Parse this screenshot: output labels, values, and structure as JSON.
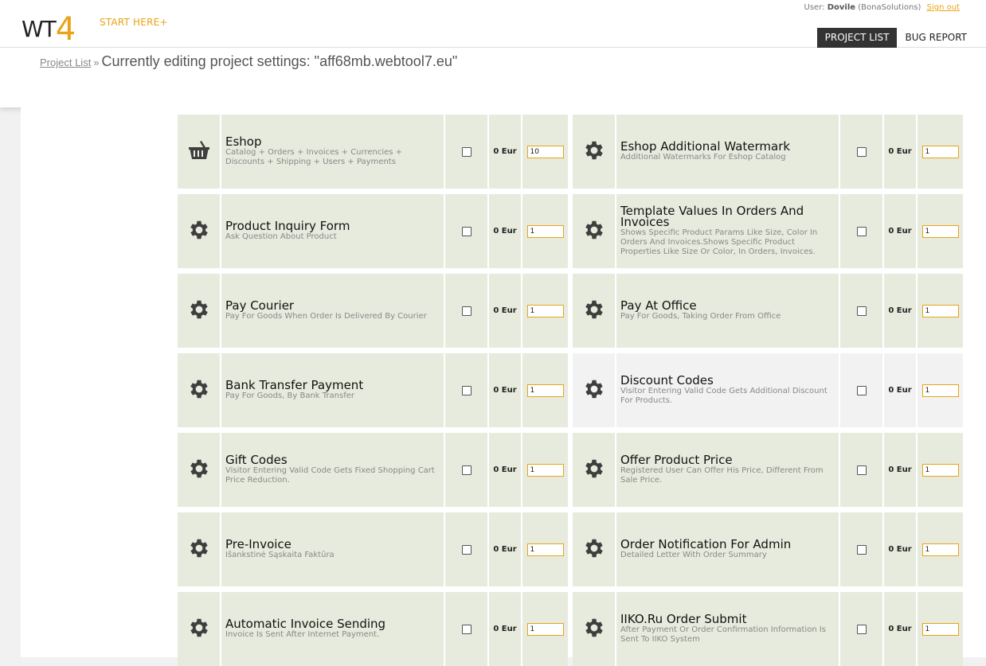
{
  "header": {
    "logo_text": "WT",
    "logo_accent": "4",
    "start_here": "START HERE+",
    "user_prefix": "User:",
    "user_name": "Dovile",
    "user_org": "(BonaSolutions)",
    "sign_out": "Sign out",
    "nav": {
      "project_list": "PROJECT LIST",
      "bug_report": "BUG REPORT"
    }
  },
  "breadcrumb": {
    "link": "Project List",
    "separator": "»",
    "current": "Currently editing project settings: \"aff68mb.webtool7.eu\""
  },
  "colors": {
    "accent": "#e8a316",
    "row_bg": "#e7ebdd",
    "row_alt_bg": "#f2f2f2",
    "nav_active": "#333333"
  },
  "modules": [
    [
      {
        "icon": "basket-icon",
        "title": "Eshop",
        "desc": "Catalog + Orders + Invoices + Currencies + Discounts + Shipping + Users + Payments",
        "price": "0 Eur",
        "qty": "10"
      },
      {
        "icon": "gear-icon",
        "title": "Eshop Additional Watermark",
        "desc": "Additional Watermarks For Eshop Catalog",
        "price": "0 Eur",
        "qty": "1"
      }
    ],
    [
      {
        "icon": "gear-icon",
        "title": "Product Inquiry Form",
        "desc": "Ask Question About Product",
        "price": "0 Eur",
        "qty": "1"
      },
      {
        "icon": "gear-icon",
        "title": "Template Values In Orders And Invoices",
        "desc": "Shows Specific Product Params Like Size, Color In Orders And Invoices.Shows Specific Product Properties Like Size Or Color, In Orders, Invoices.",
        "price": "0 Eur",
        "qty": "1"
      }
    ],
    [
      {
        "icon": "gear-icon",
        "title": "Pay Courier",
        "desc": "Pay For Goods When Order Is Delivered By Courier",
        "price": "0 Eur",
        "qty": "1"
      },
      {
        "icon": "gear-icon",
        "title": "Pay At Office",
        "desc": "Pay For Goods, Taking Order From Office",
        "price": "0 Eur",
        "qty": "1"
      }
    ],
    [
      {
        "icon": "gear-icon",
        "title": "Bank Transfer Payment",
        "desc": "Pay For Goods, By Bank Transfer",
        "price": "0 Eur",
        "qty": "1"
      },
      {
        "icon": "gear-icon",
        "title": "Discount Codes",
        "desc": "Visitor Entering Valid Code Gets Additional Discount For Products.",
        "price": "0 Eur",
        "qty": "1"
      }
    ],
    [
      {
        "icon": "gear-icon",
        "title": "Gift Codes",
        "desc": "Visitor Entering Valid Code Gets Fixed Shopping Cart Price Reduction.",
        "price": "0 Eur",
        "qty": "1"
      },
      {
        "icon": "gear-icon",
        "title": "Offer Product Price",
        "desc": "Registered User Can Offer His Price, Different From Sale Price.",
        "price": "0 Eur",
        "qty": "1"
      }
    ],
    [
      {
        "icon": "gear-icon",
        "title": "Pre-Invoice",
        "desc": "Išankstinė Sąskaita Faktūra",
        "price": "0 Eur",
        "qty": "1"
      },
      {
        "icon": "gear-icon",
        "title": "Order Notification For Admin",
        "desc": "Detailed Letter With Order Summary",
        "price": "0 Eur",
        "qty": "1"
      }
    ],
    [
      {
        "icon": "gear-icon",
        "title": "Automatic Invoice Sending",
        "desc": "Invoice Is Sent After Internet Payment.",
        "price": "0 Eur",
        "qty": "1"
      },
      {
        "icon": "gear-icon",
        "title": "IIKO.Ru Order Submit",
        "desc": "After Payment Or Order Confirmation Information Is Sent To IIKO System",
        "price": "0 Eur",
        "qty": "1"
      }
    ]
  ]
}
